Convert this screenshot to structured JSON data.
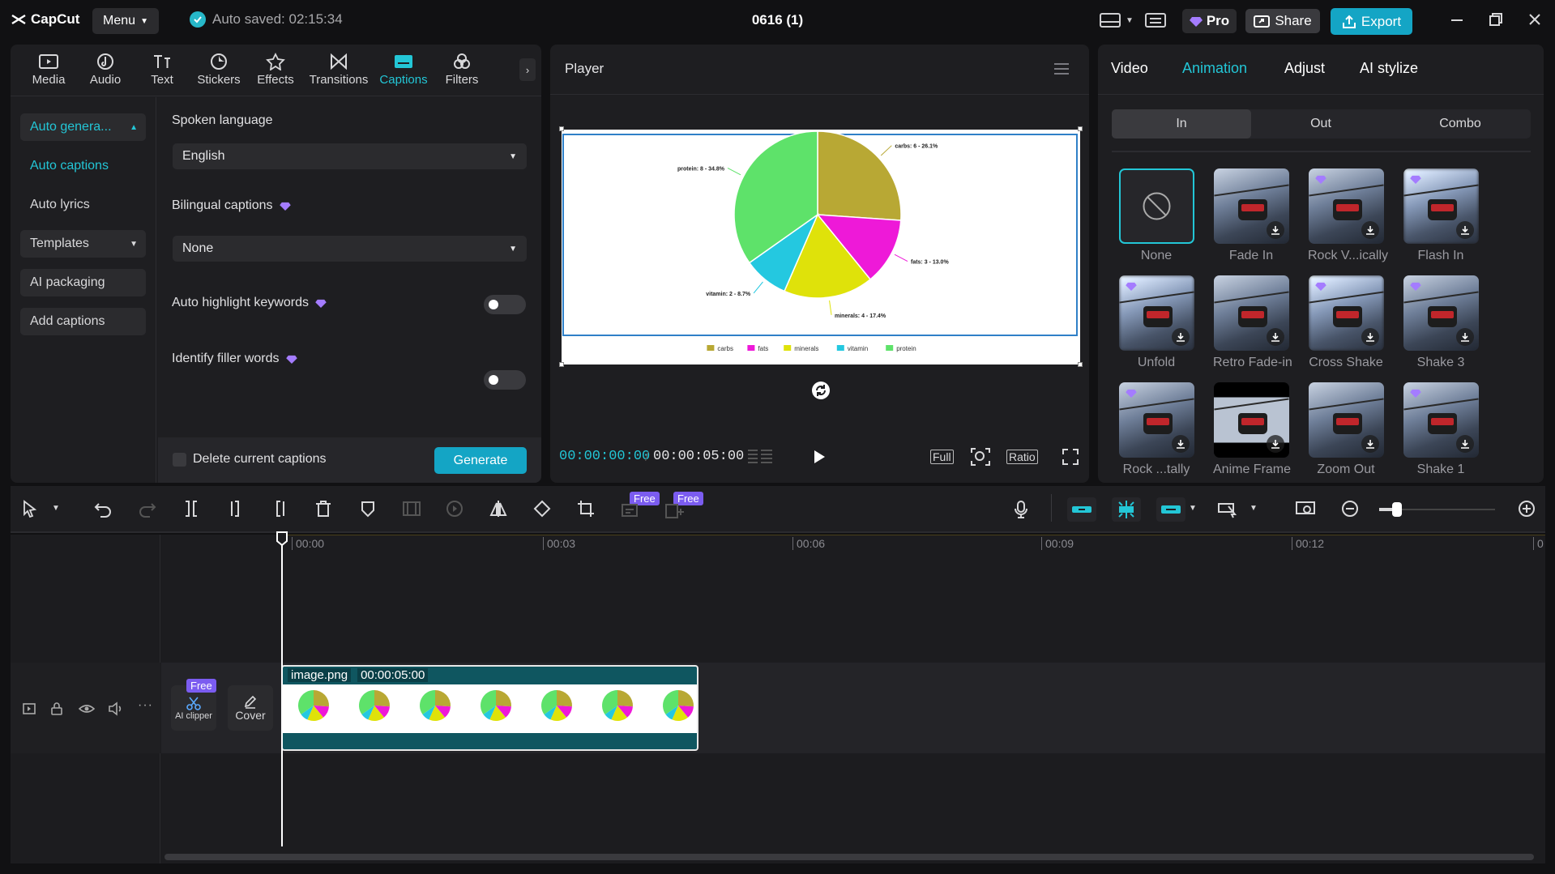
{
  "app": {
    "name": "CapCut",
    "menu_label": "Menu",
    "autosave": "Auto saved: 02:15:34",
    "project_title": "0616 (1)"
  },
  "topbar": {
    "pro_label": "Pro",
    "share_label": "Share",
    "export_label": "Export"
  },
  "tools": [
    {
      "label": "Media",
      "icon": "media-icon"
    },
    {
      "label": "Audio",
      "icon": "audio-icon"
    },
    {
      "label": "Text",
      "icon": "text-icon"
    },
    {
      "label": "Stickers",
      "icon": "stickers-icon"
    },
    {
      "label": "Effects",
      "icon": "effects-icon"
    },
    {
      "label": "Transitions",
      "icon": "transitions-icon"
    },
    {
      "label": "Captions",
      "icon": "captions-icon"
    },
    {
      "label": "Filters",
      "icon": "filters-icon"
    }
  ],
  "sidenav": {
    "auto_generate": "Auto genera...",
    "auto_captions": "Auto captions",
    "auto_lyrics": "Auto lyrics",
    "templates": "Templates",
    "ai_packaging": "AI packaging",
    "add_captions": "Add captions"
  },
  "captions": {
    "spoken_language_label": "Spoken language",
    "spoken_language_value": "English",
    "bilingual_label": "Bilingual captions",
    "bilingual_value": "None",
    "highlight_label": "Auto highlight keywords",
    "filler_label": "Identify filler words",
    "delete_label": "Delete current captions",
    "generate_label": "Generate"
  },
  "player": {
    "title": "Player",
    "time_current": "00:00:00:00",
    "time_total": "00:00:05:00",
    "btn_full": "Full",
    "btn_ratio": "Ratio"
  },
  "chart_data": {
    "type": "pie",
    "categories": [
      "carbs",
      "fats",
      "minerals",
      "vitamin",
      "protein"
    ],
    "values": [
      6,
      3,
      4,
      2,
      8
    ],
    "labels": [
      "carbs: 6 - 26.1%",
      "fats: 3 - 13.0%",
      "minerals: 4 - 17.4%",
      "vitamin: 2 - 8.7%",
      "protein: 8 - 34.8%"
    ],
    "colors": [
      "#b8a834",
      "#ee19d8",
      "#dfe20a",
      "#24c8e0",
      "#5ee26a"
    ],
    "legend_position": "bottom"
  },
  "right": {
    "tabs": [
      "Video",
      "Animation",
      "Adjust",
      "AI stylize"
    ],
    "segments": [
      "In",
      "Out",
      "Combo"
    ],
    "animations": [
      "None",
      "Fade In",
      "Rock V...ically",
      "Flash In",
      "Unfold",
      "Retro Fade-in",
      "Cross Shake",
      "Shake 3",
      "Rock ...tally",
      "Anime Frame",
      "Zoom Out",
      "Shake 1"
    ]
  },
  "timeline": {
    "ruler": [
      "00:00",
      "00:03",
      "00:06",
      "00:09",
      "00:12",
      "0"
    ],
    "free_badge": "Free",
    "ai_clipper": "AI clipper",
    "cover": "Cover",
    "clip_name": "image.png",
    "clip_duration": "00:00:05:00"
  }
}
